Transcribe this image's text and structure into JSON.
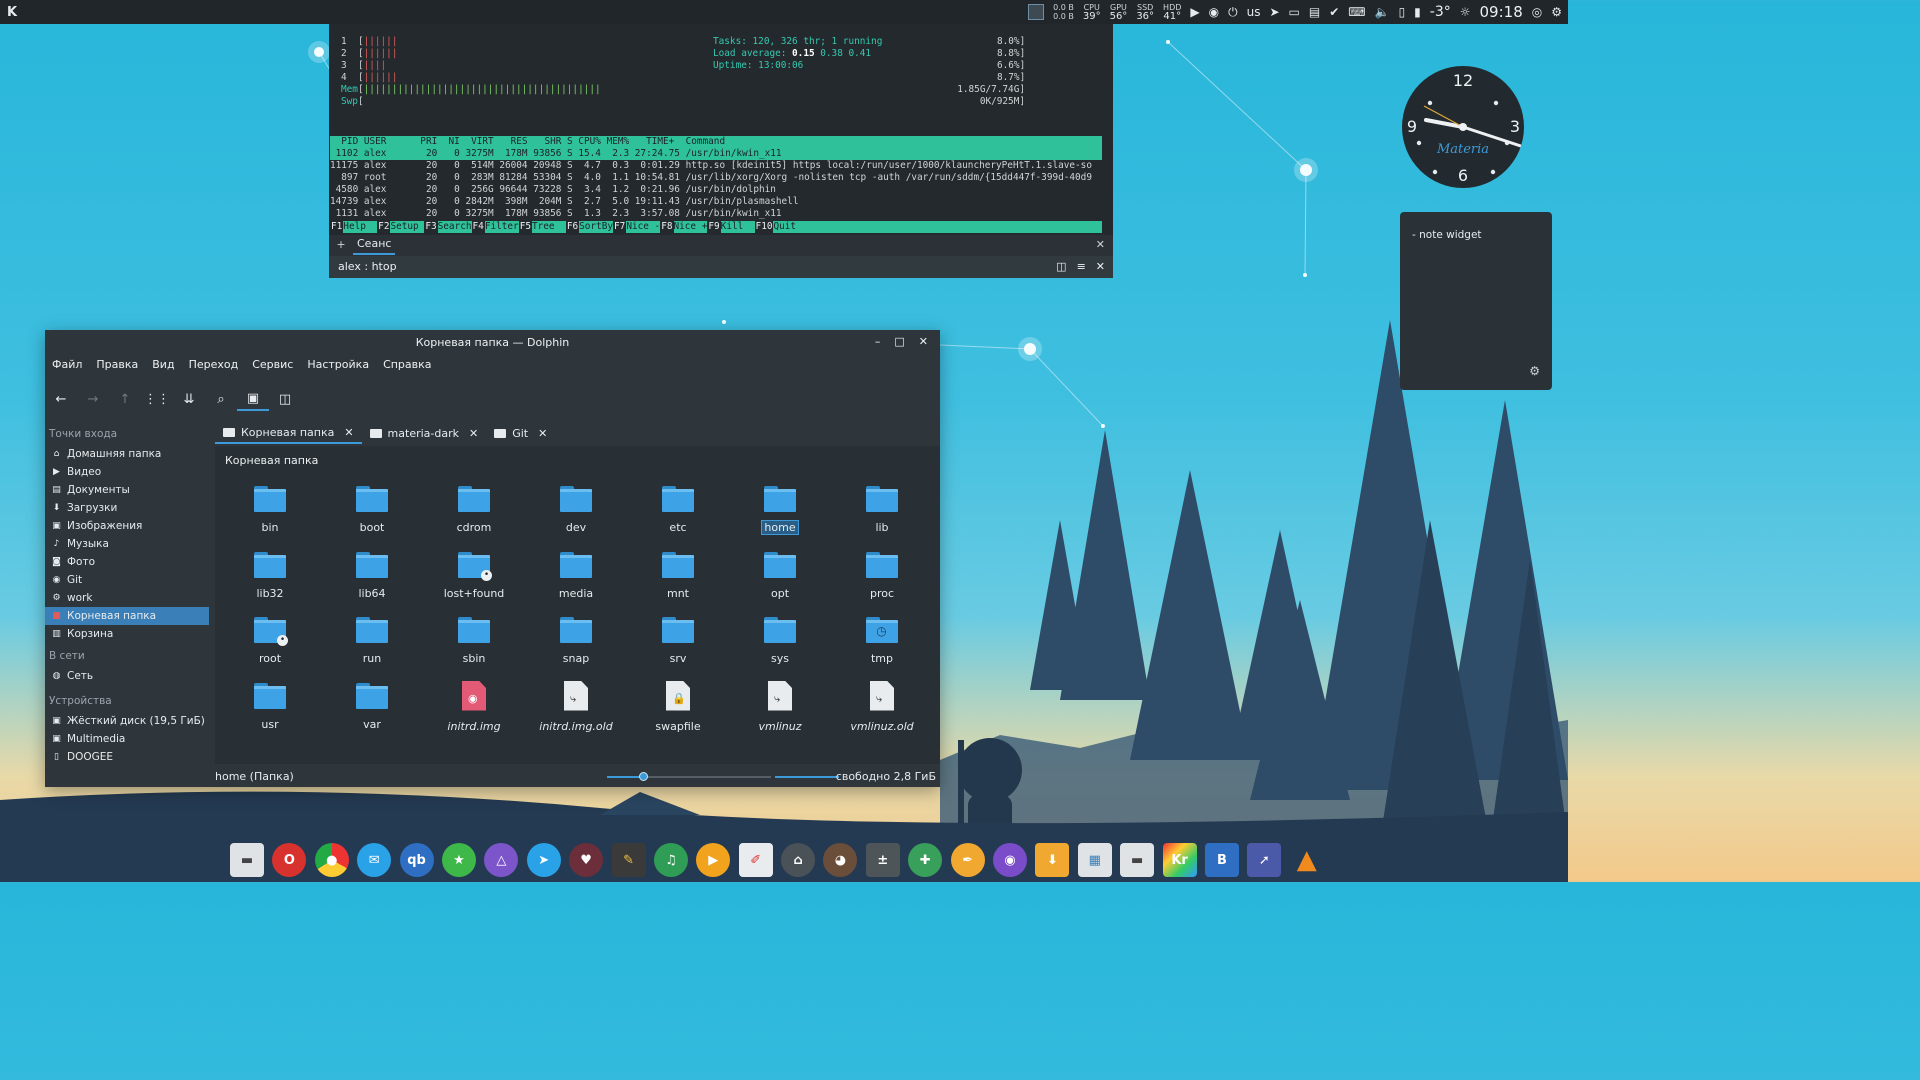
{
  "top_panel": {
    "net": {
      "down": "0.0 B",
      "up": "0.0 B"
    },
    "sensors": [
      {
        "label": "CPU",
        "value": "39°"
      },
      {
        "label": "GPU",
        "value": "56°"
      },
      {
        "label": "SSD",
        "value": "36°"
      },
      {
        "label": "HDD",
        "value": "41°"
      }
    ],
    "keyboard_layout": "us",
    "temperature": "-3°",
    "time": "09:18"
  },
  "terminal": {
    "cpus": [
      {
        "id": "1",
        "bars": "||||||",
        "pct": "8.0%"
      },
      {
        "id": "2",
        "bars": "||||||",
        "pct": "8.8%"
      },
      {
        "id": "3",
        "bars": "||||",
        "pct": "6.6%"
      },
      {
        "id": "4",
        "bars": "||||||",
        "pct": "8.7%"
      }
    ],
    "mem_label": "Mem",
    "mem_bars": "||||||||||||||||||||||||||||||||||||||||||",
    "mem_value": "1.85G/7.74G",
    "swp_label": "Swp",
    "swp_value": "0K/925M",
    "tasks_label": "Tasks:",
    "tasks_value": "120, 326 thr; 1 running",
    "load_label": "Load average:",
    "load_1": "0.15",
    "load_rest": "0.38 0.41",
    "uptime_label": "Uptime:",
    "uptime_value": "13:00:06",
    "header": "  PID USER      PRI  NI  VIRT   RES   SHR S CPU% MEM%   TIME+  Command",
    "rows": [
      " 1102 alex       20   0 3275M  178M 93856 S 15.4  2.3 27:24.75 /usr/bin/kwin_x11",
      "11175 alex       20   0  514M 26004 20948 S  4.7  0.3  0:01.29 http.so [kdeinit5] https local:/run/user/1000/klauncheryPeHtT.1.slave-so",
      "  897 root       20   0  283M 81284 53304 S  4.0  1.1 10:54.81 /usr/lib/xorg/Xorg -nolisten tcp -auth /var/run/sddm/{15dd447f-399d-40d9",
      " 4580 alex       20   0  256G 96644 73228 S  3.4  1.2  0:21.96 /usr/bin/dolphin",
      "14739 alex       20   0 2842M  398M  204M S  2.7  5.0 19:11.43 /usr/bin/plasmashell",
      " 1131 alex       20   0 3275M  178M 93856 S  1.3  2.3  3:57.08 /usr/bin/kwin_x11"
    ],
    "fkeys": [
      {
        "key": "F1",
        "label": "Help  "
      },
      {
        "key": "F2",
        "label": "Setup "
      },
      {
        "key": "F3",
        "label": "Search"
      },
      {
        "key": "F4",
        "label": "Filter"
      },
      {
        "key": "F5",
        "label": "Tree  "
      },
      {
        "key": "F6",
        "label": "SortBy"
      },
      {
        "key": "F7",
        "label": "Nice -"
      },
      {
        "key": "F8",
        "label": "Nice +"
      },
      {
        "key": "F9",
        "label": "Kill  "
      },
      {
        "key": "F10",
        "label": "Quit"
      }
    ],
    "tab_label": "Сеанс",
    "title": "alex : htop"
  },
  "dolphin": {
    "title": "Корневая папка — Dolphin",
    "menu": [
      "Файл",
      "Правка",
      "Вид",
      "Переход",
      "Сервис",
      "Настройка",
      "Справка"
    ],
    "places_title": "Точки входа",
    "places": [
      "Домашняя папка",
      "Видео",
      "Документы",
      "Загрузки",
      "Изображения",
      "Музыка",
      "Фото",
      "Git",
      "work",
      "Корневая папка",
      "Корзина"
    ],
    "network_title": "В сети",
    "network": [
      "Сеть"
    ],
    "devices_title": "Устройства",
    "devices": [
      "Жёсткий диск (19,5 ГиБ)",
      "Multimedia",
      "DOOGEE"
    ],
    "tabs": [
      "Корневая папка",
      "materia-dark",
      "Git"
    ],
    "breadcrumb": "Корневая папка",
    "items": [
      {
        "name": "bin"
      },
      {
        "name": "boot"
      },
      {
        "name": "cdrom"
      },
      {
        "name": "dev"
      },
      {
        "name": "etc"
      },
      {
        "name": "home"
      },
      {
        "name": "lib"
      },
      {
        "name": "lib32"
      },
      {
        "name": "lib64"
      },
      {
        "name": "lost+found"
      },
      {
        "name": "media"
      },
      {
        "name": "mnt"
      },
      {
        "name": "opt"
      },
      {
        "name": "proc"
      },
      {
        "name": "root"
      },
      {
        "name": "run"
      },
      {
        "name": "sbin"
      },
      {
        "name": "snap"
      },
      {
        "name": "srv"
      },
      {
        "name": "sys"
      },
      {
        "name": "tmp"
      },
      {
        "name": "usr"
      },
      {
        "name": "var"
      },
      {
        "name": "initrd.img"
      },
      {
        "name": "initrd.img.old"
      },
      {
        "name": "swapfile"
      },
      {
        "name": "vmlinuz"
      },
      {
        "name": "vmlinuz.old"
      }
    ],
    "status": "home (Папка)",
    "zoom_level": 0.22,
    "free_space": "свободно 2,8 ГиБ"
  },
  "clock_widget": {
    "n12": "12",
    "n3": "3",
    "n6": "6",
    "n9": "9",
    "brand": "Materia"
  },
  "note_widget": {
    "text": "- note widget"
  },
  "colors": {
    "accent": "#3d9ad8",
    "htop_green": "#2fc29a",
    "folder": "#3ea3e6"
  }
}
